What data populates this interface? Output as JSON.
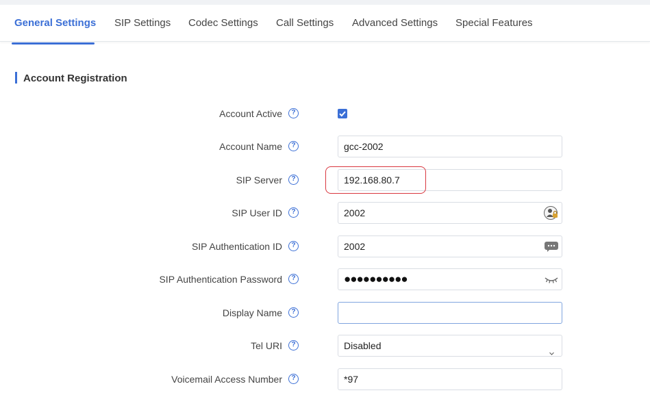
{
  "tabs": [
    {
      "label": "General Settings",
      "active": true
    },
    {
      "label": "SIP Settings",
      "active": false
    },
    {
      "label": "Codec Settings",
      "active": false
    },
    {
      "label": "Call Settings",
      "active": false
    },
    {
      "label": "Advanced Settings",
      "active": false
    },
    {
      "label": "Special Features",
      "active": false
    }
  ],
  "section": {
    "title": "Account Registration"
  },
  "fields": {
    "account_active": {
      "label": "Account Active",
      "checked": true
    },
    "account_name": {
      "label": "Account Name",
      "value": "gcc-2002"
    },
    "sip_server": {
      "label": "SIP Server",
      "value": "192.168.80.7"
    },
    "sip_user_id": {
      "label": "SIP User ID",
      "value": "2002",
      "icon": "user-lock-icon"
    },
    "sip_auth_id": {
      "label": "SIP Authentication ID",
      "value": "2002",
      "icon": "message-dots-icon"
    },
    "sip_auth_password": {
      "label": "SIP Authentication Password",
      "masked_value": "●●●●●●●●●●",
      "icon": "eye-hidden-icon"
    },
    "display_name": {
      "label": "Display Name",
      "value": ""
    },
    "tel_uri": {
      "label": "Tel URI",
      "value": "Disabled"
    },
    "voicemail_access_number": {
      "label": "Voicemail Access Number",
      "value": "*97"
    }
  },
  "colors": {
    "accent": "#3b6fd6",
    "highlight": "#d9363e"
  }
}
